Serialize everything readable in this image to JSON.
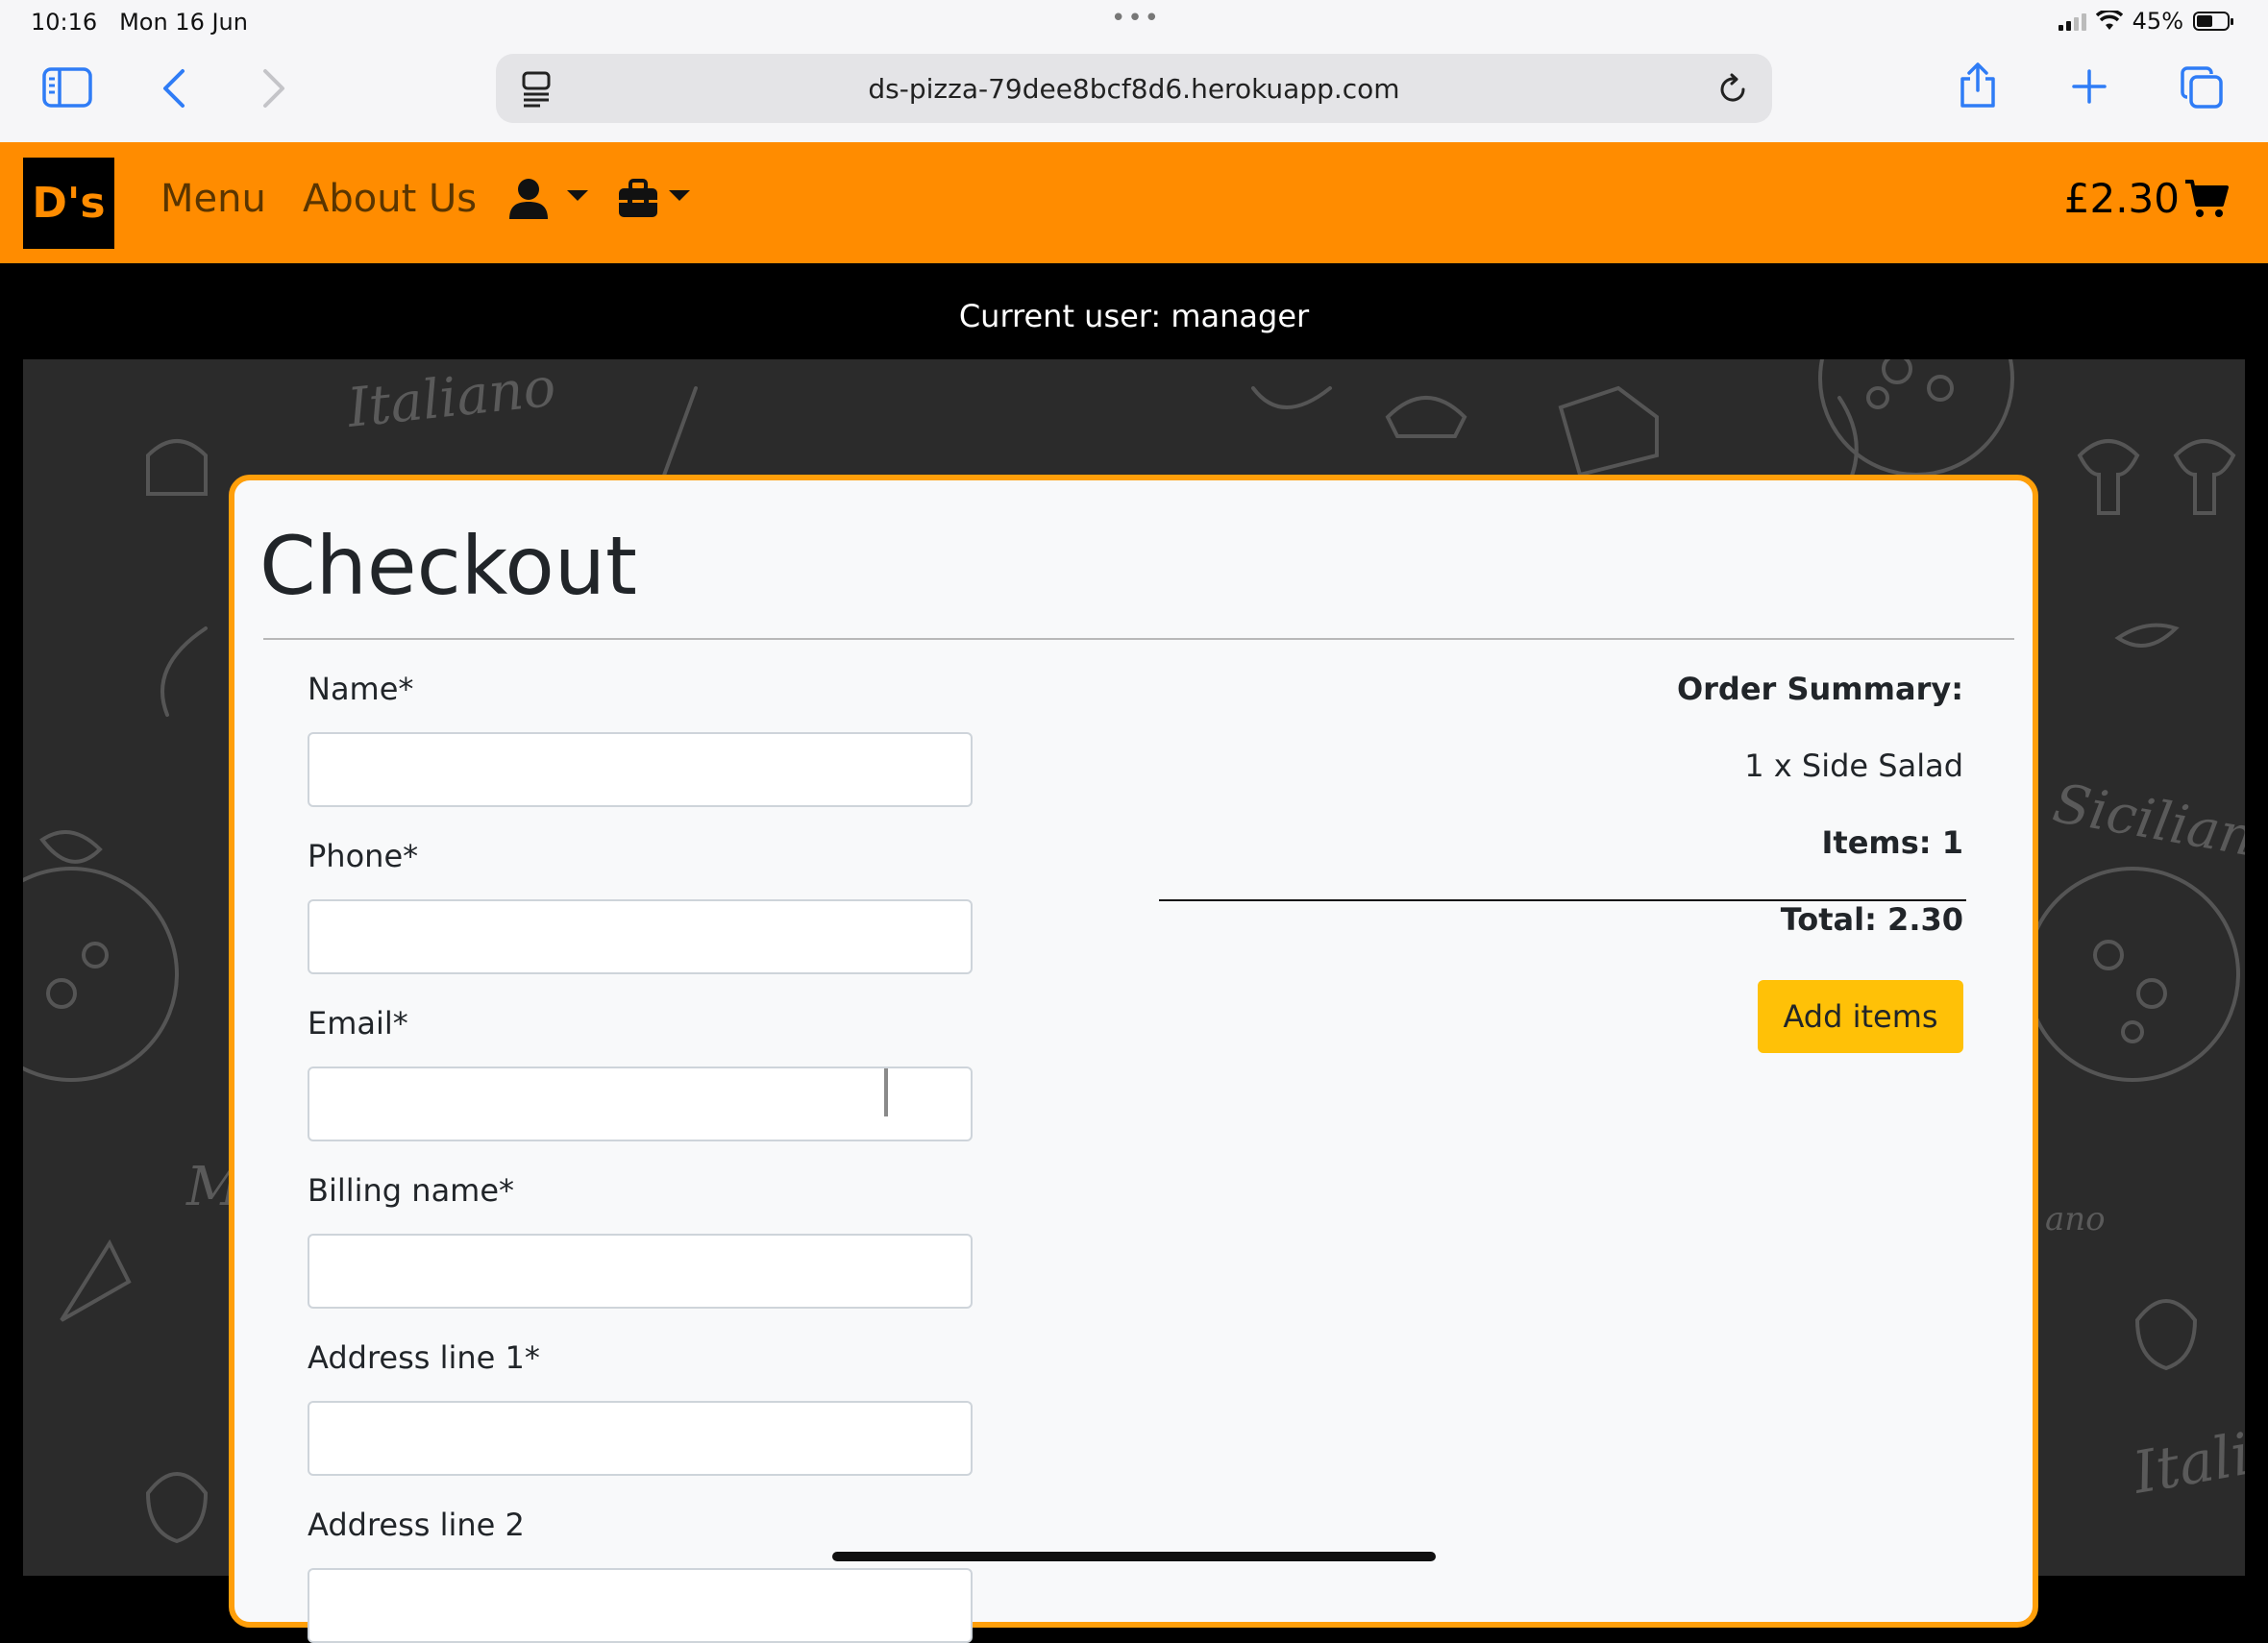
{
  "status_bar": {
    "time": "10:16",
    "date": "Mon 16 Jun",
    "battery": "45%"
  },
  "browser": {
    "url": "ds-pizza-79dee8bcf8d6.herokuapp.com"
  },
  "nav": {
    "logo_text": "D's",
    "links": [
      "Menu",
      "About Us"
    ],
    "cart_total": "£2.30",
    "brand_color": "#ff8c00"
  },
  "user_strip": {
    "text": "Current user: manager"
  },
  "checkout": {
    "title": "Checkout",
    "fields": [
      {
        "label": "Name*",
        "value": ""
      },
      {
        "label": "Phone*",
        "value": ""
      },
      {
        "label": "Email*",
        "value": ""
      },
      {
        "label": "Billing name*",
        "value": ""
      },
      {
        "label": "Address line 1*",
        "value": ""
      },
      {
        "label": "Address line 2",
        "value": ""
      }
    ],
    "summary": {
      "heading": "Order Summary:",
      "item": "1 x Side Salad",
      "items_count": "Items: 1",
      "total": "Total: 2.30",
      "add_items_label": "Add items"
    }
  },
  "icons": {
    "sidebar": "sidebar-icon",
    "back": "back-icon",
    "forward": "forward-icon",
    "reader": "reader-icon",
    "reload": "reload-icon",
    "share": "share-icon",
    "new_tab": "plus-icon",
    "tabs": "tabs-icon",
    "user": "user-icon",
    "toolbox": "toolbox-icon",
    "cart": "cart-icon"
  }
}
